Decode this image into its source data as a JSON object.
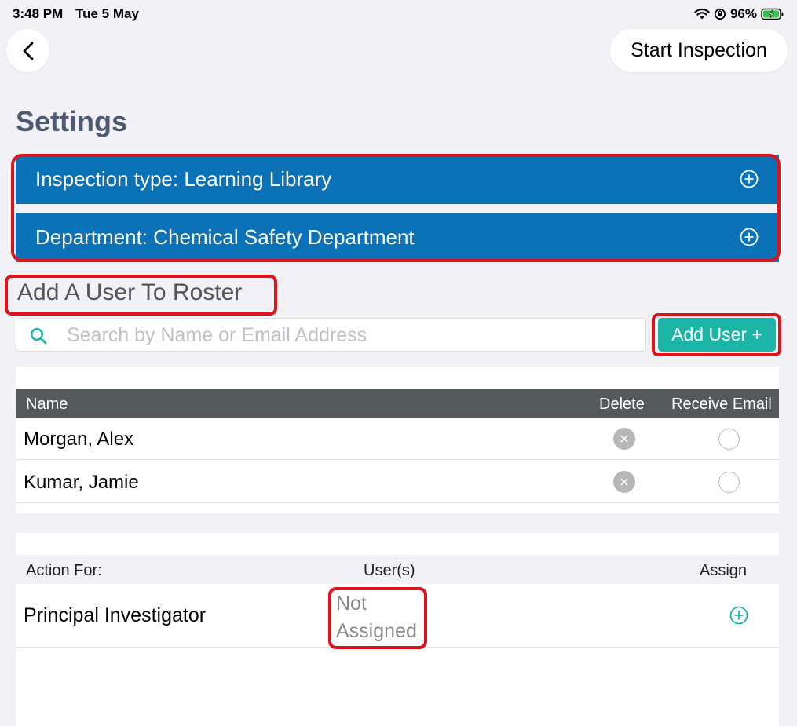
{
  "status_bar": {
    "time": "3:48 PM",
    "date": "Tue 5 May",
    "battery": "96%"
  },
  "nav": {
    "start_label": "Start Inspection"
  },
  "page_title": "Settings",
  "settings": {
    "inspection_type": "Inspection type: Learning Library",
    "department": "Department: Chemical Safety Department"
  },
  "roster": {
    "title": "Add A User To Roster",
    "search_placeholder": "Search by Name or Email Address",
    "add_user_label": "Add User +",
    "columns": {
      "name": "Name",
      "delete": "Delete",
      "receive_email": "Receive Email"
    },
    "users": [
      {
        "name": "Morgan,  Alex"
      },
      {
        "name": "Kumar,  Jamie"
      }
    ]
  },
  "actions": {
    "columns": {
      "action_for": "Action For:",
      "users": "User(s)",
      "assign": "Assign"
    },
    "rows": [
      {
        "role": "Principal Investigator",
        "users": "Not Assigned"
      }
    ]
  },
  "colors": {
    "accent_blue": "#0b72b8",
    "teal": "#1db4a8",
    "highlight_red": "#e0131b",
    "title_slate": "#4c5a73"
  }
}
